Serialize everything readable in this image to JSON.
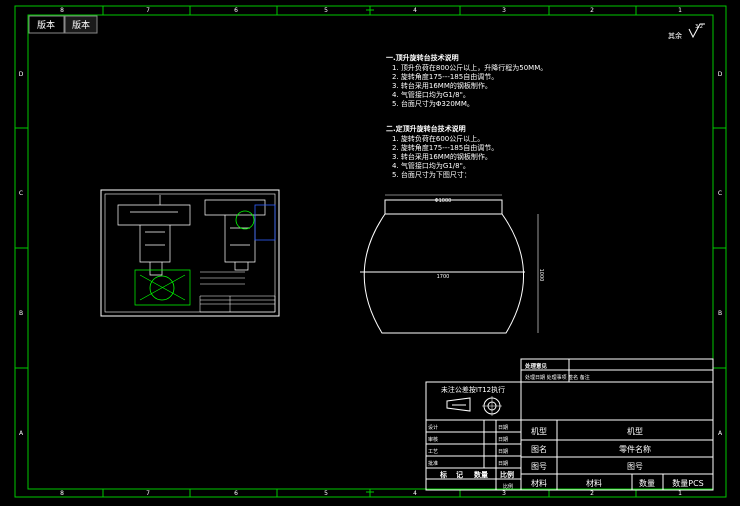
{
  "tabs": {
    "model": "版本",
    "layout": "版本"
  },
  "frame": {
    "cols_top": [
      "8",
      "7",
      "6",
      "5",
      "4",
      "3",
      "2",
      "1"
    ],
    "cols_bottom": [
      "8",
      "7",
      "6",
      "5",
      "4",
      "3",
      "2",
      "1"
    ],
    "rows_left": [
      "D",
      "C",
      "B",
      "A"
    ],
    "rows_right": [
      "D",
      "C",
      "B",
      "A"
    ]
  },
  "roughness": {
    "label": "其余",
    "value": "3.2"
  },
  "notes1": {
    "heading": "一.顶升旋转台技术说明",
    "items": [
      "1. 顶升负荷在800公斤以上，升降行程为50MM。",
      "2. 旋转角度175---185自由调节。",
      "3. 转台采用16MM的钢板制作。",
      "4. 气管接口均为G1/8\"。",
      "5. 台面尺寸为Φ320MM。"
    ]
  },
  "notes2": {
    "heading": "二.定顶升旋转台技术说明",
    "items": [
      "1. 旋转负荷在600公斤以上。",
      "2. 旋转角度175---185自由调节。",
      "3. 转台采用16MM的钢板制作。",
      "4. 气管接口均为G1/8\"。",
      "5. 台面尺寸为下图尺寸："
    ]
  },
  "dims": {
    "top": "Φ1000",
    "width": "1700",
    "height": "1000"
  },
  "title_block": {
    "top_rows": [
      "处理意见",
      "处理日期  处理事项  签名  备注"
    ],
    "tolerance": "未注公差按IT12执行",
    "sign_rows": [
      {
        "label": "设计",
        "date": "日期"
      },
      {
        "label": "审核",
        "date": "日期"
      },
      {
        "label": "工艺",
        "date": "日期"
      },
      {
        "label": "批准",
        "date": "日期"
      }
    ],
    "footer_labels": [
      "标",
      "记",
      "数量",
      "比例"
    ],
    "ratio_label": "比例",
    "fields": [
      {
        "label": "机型",
        "value": "机型"
      },
      {
        "label": "图名",
        "value": "零件名称"
      },
      {
        "label": "图号",
        "value": "图号"
      }
    ],
    "material_label": "材料",
    "material_value": "材料",
    "qty_label": "数量",
    "qty_value": "数量PCS"
  }
}
